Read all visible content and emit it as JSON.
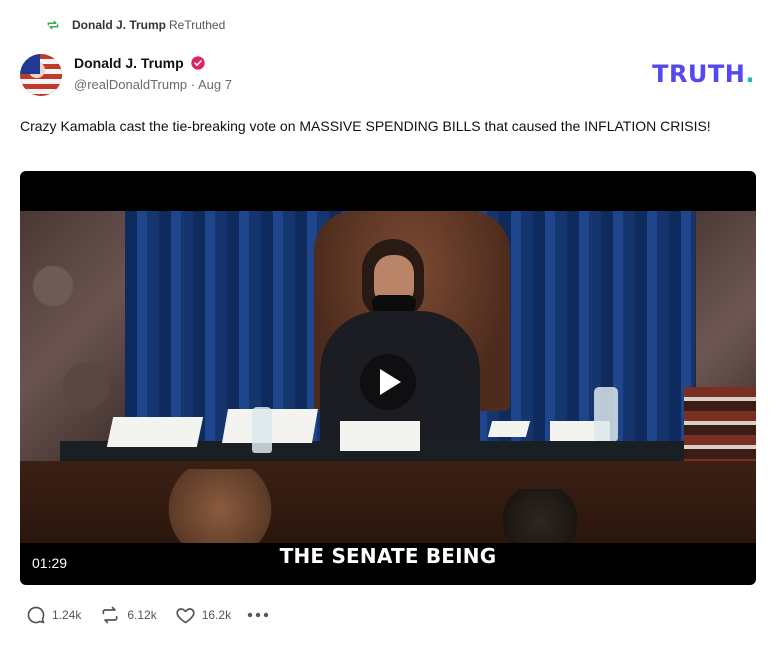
{
  "retruth": {
    "name": "Donald J. Trump",
    "suffix": "ReTruthed",
    "icon": "retruth-icon",
    "color": "#2fb14f"
  },
  "author": {
    "display_name": "Donald J. Trump",
    "handle": "@realDonaldTrump",
    "date": "Aug 7",
    "meta": "@realDonaldTrump · Aug 7",
    "verified_icon": "verified-badge-icon",
    "verified_color": "#e0245e"
  },
  "brand": {
    "text": "TRUTH",
    "dot": ".",
    "color": "#5448ee",
    "dot_color": "#17c3a5"
  },
  "post": {
    "text": "Crazy Kamabla cast the tie-breaking vote on MASSIVE SPENDING BILLS that caused the INFLATION CRISIS!"
  },
  "video": {
    "caption": "THE SENATE BEING",
    "duration": "01:29",
    "play_icon": "play-icon"
  },
  "actions": {
    "replies": "1.24k",
    "retruths": "6.12k",
    "likes": "16.2k",
    "reply_icon": "comment-icon",
    "retruth_icon": "retruth-icon",
    "like_icon": "heart-icon",
    "more_icon": "more-dots-icon"
  }
}
